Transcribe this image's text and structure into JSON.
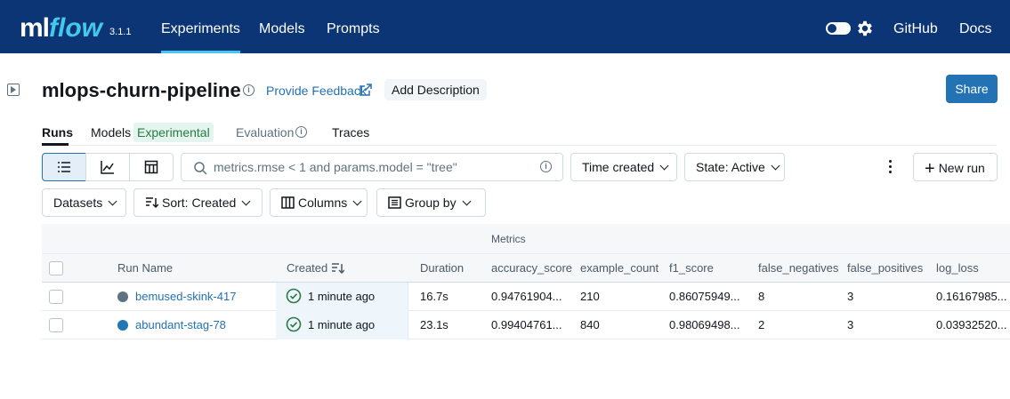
{
  "topnav": {
    "logo_ml": "ml",
    "logo_flow": "flow",
    "version": "3.1.1",
    "items": [
      "Experiments",
      "Models",
      "Prompts"
    ],
    "right_links": [
      "GitHub",
      "Docs"
    ]
  },
  "header": {
    "title": "mlops-churn-pipeline",
    "feedback_label": "Provide Feedback",
    "add_description": "Add Description",
    "share_label": "Share"
  },
  "tabs": {
    "runs": "Runs",
    "models": "Models",
    "experimental_badge": "Experimental",
    "evaluation": "Evaluation",
    "traces": "Traces"
  },
  "toolbar": {
    "search_value": "metrics.rmse < 1 and params.model = \"tree\"",
    "time_created": "Time created",
    "state": "State: Active",
    "new_run": "New run",
    "datasets": "Datasets",
    "sort": "Sort: Created",
    "columns": "Columns",
    "group_by": "Group by"
  },
  "table": {
    "group_header": "Metrics",
    "headers": [
      "Run Name",
      "Created",
      "Duration",
      "accuracy_score",
      "example_count",
      "f1_score",
      "false_negatives",
      "false_positives",
      "log_loss"
    ],
    "rows": [
      {
        "name": "bemused-skink-417",
        "color": "#5f7281",
        "created": "1 minute ago",
        "duration": "16.7s",
        "accuracy_score": "0.94761904...",
        "example_count": "210",
        "f1_score": "0.86075949...",
        "false_negatives": "8",
        "false_positives": "3",
        "log_loss": "0.16167985..."
      },
      {
        "name": "abundant-stag-78",
        "color": "#1f77b4",
        "created": "1 minute ago",
        "duration": "23.1s",
        "accuracy_score": "0.99404761...",
        "example_count": "840",
        "f1_score": "0.98069498...",
        "false_negatives": "2",
        "false_positives": "3",
        "log_loss": "0.03932520..."
      }
    ]
  },
  "colors": {
    "topbar": "#0b3574",
    "accent": "#43c9ed",
    "primary": "#2272b4",
    "success": "#277c43"
  }
}
